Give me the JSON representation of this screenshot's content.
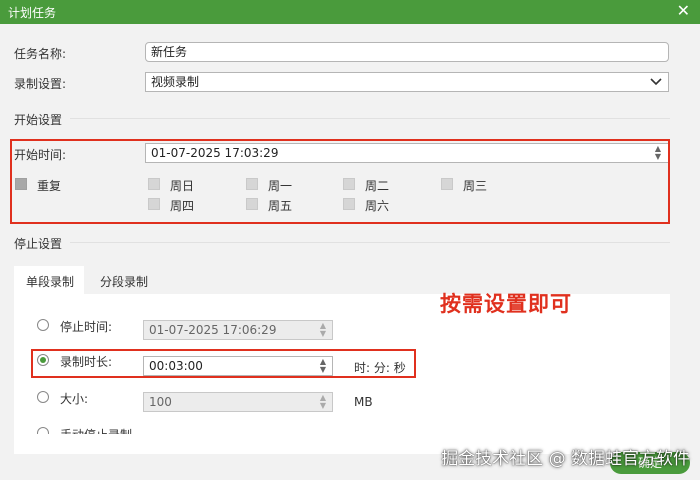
{
  "window": {
    "title": "计划任务",
    "close_label": "✕"
  },
  "task_name": {
    "label": "任务名称:",
    "value": "新任务"
  },
  "record_setting": {
    "label": "录制设置:",
    "value": "视频录制"
  },
  "start_settings": {
    "section_title": "开始设置",
    "start_time_label": "开始时间:",
    "start_time_value": "01-07-2025 17:03:29",
    "repeat_label": "重复",
    "days": [
      "周日",
      "周一",
      "周二",
      "周三",
      "周四",
      "周五",
      "周六"
    ]
  },
  "stop_settings": {
    "section_title": "停止设置",
    "tabs": [
      "单段录制",
      "分段录制"
    ],
    "active_tab": "单段录制",
    "stop_time_label": "停止时间:",
    "stop_time_value": "01-07-2025 17:06:29",
    "duration_label": "录制时长:",
    "duration_value": "00:03:00",
    "duration_unit": "时: 分: 秒",
    "size_label": "大小:",
    "size_value": "100",
    "size_unit": "MB",
    "manual_stop_label": "手动停止录制",
    "selected_option": "录制时长"
  },
  "annotation": "按需设置即可",
  "watermark": "掘金技术社区 @ 数据蛙官方软件",
  "ok_button": "确定",
  "colors": {
    "title_bar": "#4a9b3c",
    "highlight_box": "#e0301e",
    "annotation": "#e0301e"
  },
  "icons": {
    "close": "close-icon",
    "dropdown": "chevron-down-icon",
    "spinner": "spinner-arrows-icon"
  }
}
